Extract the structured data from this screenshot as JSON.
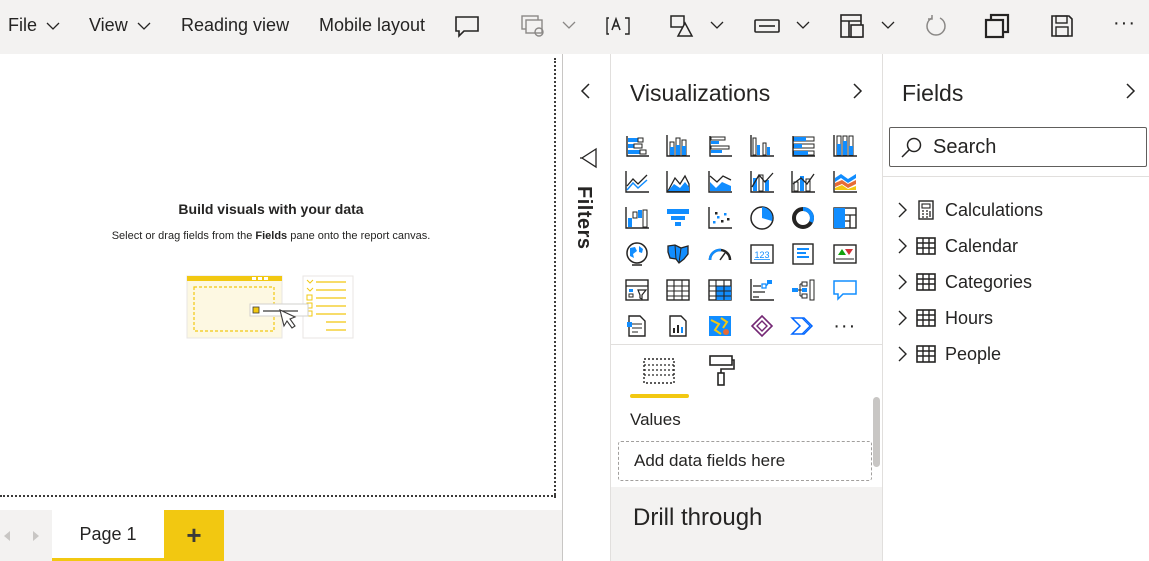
{
  "ribbon": {
    "file": "File",
    "view": "View",
    "reading_view": "Reading view",
    "mobile_layout": "Mobile layout",
    "more": "···"
  },
  "canvas": {
    "title": "Build visuals with your data",
    "subtitle_before": "Select or drag fields from the ",
    "subtitle_bold": "Fields",
    "subtitle_after": " pane onto the report canvas."
  },
  "page_tabs": {
    "current": "Page 1",
    "add": "+"
  },
  "filters": {
    "label": "Filters"
  },
  "visualizations": {
    "title": "Visualizations",
    "more_visuals": "···",
    "values_label": "Values",
    "drop_placeholder": "Add data fields here",
    "drill_through": "Drill through",
    "icons": [
      "stacked-bar-chart-icon",
      "stacked-column-chart-icon",
      "clustered-bar-chart-icon",
      "clustered-column-chart-icon",
      "100-stacked-bar-chart-icon",
      "100-stacked-column-chart-icon",
      "line-chart-icon",
      "area-chart-icon",
      "stacked-area-chart-icon",
      "line-and-stacked-column-chart-icon",
      "line-and-clustered-column-chart-icon",
      "ribbon-chart-icon",
      "waterfall-chart-icon",
      "funnel-icon",
      "scatter-chart-icon",
      "pie-chart-icon",
      "donut-chart-icon",
      "treemap-icon",
      "map-icon",
      "filled-map-icon",
      "gauge-icon",
      "card-icon",
      "multi-row-card-icon",
      "kpi-icon",
      "slicer-icon",
      "table-icon",
      "matrix-icon",
      "key-influencers-icon",
      "decomposition-tree-icon",
      "qa-icon",
      "paginated-report-icon",
      "smart-narrative-icon",
      "azure-map-icon",
      "power-apps-icon",
      "power-automate-icon",
      "more-visuals-icon"
    ]
  },
  "fields": {
    "title": "Fields",
    "search_placeholder": "Search",
    "tables": [
      {
        "name": "Calculations",
        "icon": "calculator-table-icon"
      },
      {
        "name": "Calendar",
        "icon": "table-icon"
      },
      {
        "name": "Categories",
        "icon": "table-icon"
      },
      {
        "name": "Hours",
        "icon": "table-icon"
      },
      {
        "name": "People",
        "icon": "table-icon"
      }
    ]
  },
  "colors": {
    "accent": "#f2c811",
    "pane_bg": "#f3f2f1",
    "viz_blue": "#118dff",
    "text": "#252423"
  }
}
